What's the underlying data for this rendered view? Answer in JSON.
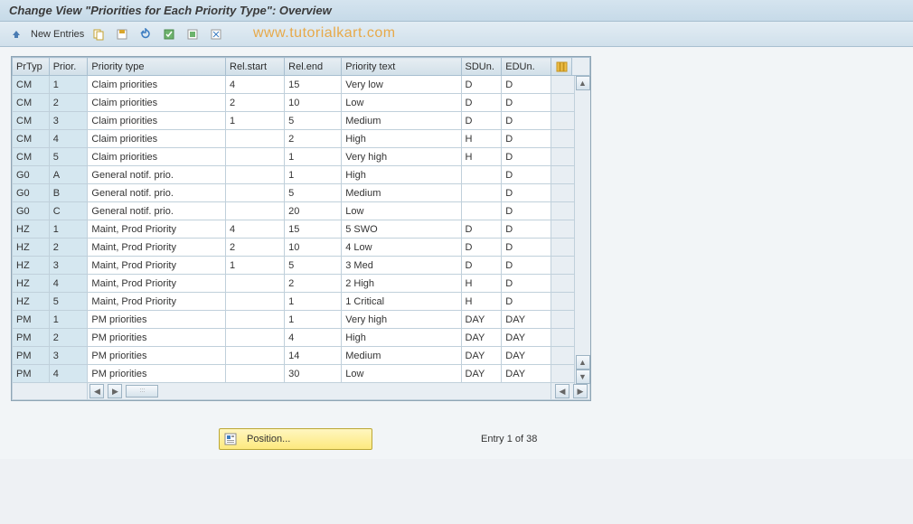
{
  "title": "Change View \"Priorities for Each Priority Type\": Overview",
  "toolbar": {
    "new_entries": "New Entries"
  },
  "watermark": "www.tutorialkart.com",
  "columns": {
    "prtyp": "PrTyp",
    "prior": "Prior.",
    "ptype": "Priority type",
    "relstart": "Rel.start",
    "relend": "Rel.end",
    "ptext": "Priority text",
    "sdun": "SDUn.",
    "edun": "EDUn."
  },
  "rows": [
    {
      "prtyp": "CM",
      "prior": "1",
      "ptype": "Claim priorities",
      "relstart": "4",
      "relend": "15",
      "ptext": "Very low",
      "sdun": "D",
      "edun": "D"
    },
    {
      "prtyp": "CM",
      "prior": "2",
      "ptype": "Claim priorities",
      "relstart": "2",
      "relend": "10",
      "ptext": "Low",
      "sdun": "D",
      "edun": "D"
    },
    {
      "prtyp": "CM",
      "prior": "3",
      "ptype": "Claim priorities",
      "relstart": "1",
      "relend": "5",
      "ptext": "Medium",
      "sdun": "D",
      "edun": "D"
    },
    {
      "prtyp": "CM",
      "prior": "4",
      "ptype": "Claim priorities",
      "relstart": "",
      "relend": "2",
      "ptext": "High",
      "sdun": "H",
      "edun": "D"
    },
    {
      "prtyp": "CM",
      "prior": "5",
      "ptype": "Claim priorities",
      "relstart": "",
      "relend": "1",
      "ptext": "Very high",
      "sdun": "H",
      "edun": "D"
    },
    {
      "prtyp": "G0",
      "prior": "A",
      "ptype": "General notif. prio.",
      "relstart": "",
      "relend": "1",
      "ptext": "High",
      "sdun": "",
      "edun": "D"
    },
    {
      "prtyp": "G0",
      "prior": "B",
      "ptype": "General notif. prio.",
      "relstart": "",
      "relend": "5",
      "ptext": "Medium",
      "sdun": "",
      "edun": "D"
    },
    {
      "prtyp": "G0",
      "prior": "C",
      "ptype": "General notif. prio.",
      "relstart": "",
      "relend": "20",
      "ptext": "Low",
      "sdun": "",
      "edun": "D"
    },
    {
      "prtyp": "HZ",
      "prior": "1",
      "ptype": "Maint, Prod Priority",
      "relstart": "4",
      "relend": "15",
      "ptext": "5 SWO",
      "sdun": "D",
      "edun": "D"
    },
    {
      "prtyp": "HZ",
      "prior": "2",
      "ptype": "Maint, Prod Priority",
      "relstart": "2",
      "relend": "10",
      "ptext": "4 Low",
      "sdun": "D",
      "edun": "D"
    },
    {
      "prtyp": "HZ",
      "prior": "3",
      "ptype": "Maint, Prod Priority",
      "relstart": "1",
      "relend": "5",
      "ptext": "3 Med",
      "sdun": "D",
      "edun": "D"
    },
    {
      "prtyp": "HZ",
      "prior": "4",
      "ptype": "Maint, Prod Priority",
      "relstart": "",
      "relend": "2",
      "ptext": "2 High",
      "sdun": "H",
      "edun": "D"
    },
    {
      "prtyp": "HZ",
      "prior": "5",
      "ptype": "Maint, Prod Priority",
      "relstart": "",
      "relend": "1",
      "ptext": "1 Critical",
      "sdun": "H",
      "edun": "D"
    },
    {
      "prtyp": "PM",
      "prior": "1",
      "ptype": "PM priorities",
      "relstart": "",
      "relend": "1",
      "ptext": "Very high",
      "sdun": "DAY",
      "edun": "DAY"
    },
    {
      "prtyp": "PM",
      "prior": "2",
      "ptype": "PM priorities",
      "relstart": "",
      "relend": "4",
      "ptext": "High",
      "sdun": "DAY",
      "edun": "DAY"
    },
    {
      "prtyp": "PM",
      "prior": "3",
      "ptype": "PM priorities",
      "relstart": "",
      "relend": "14",
      "ptext": "Medium",
      "sdun": "DAY",
      "edun": "DAY"
    },
    {
      "prtyp": "PM",
      "prior": "4",
      "ptype": "PM priorities",
      "relstart": "",
      "relend": "30",
      "ptext": "Low",
      "sdun": "DAY",
      "edun": "DAY"
    }
  ],
  "footer": {
    "position": "Position...",
    "entry_status": "Entry 1 of 38"
  }
}
